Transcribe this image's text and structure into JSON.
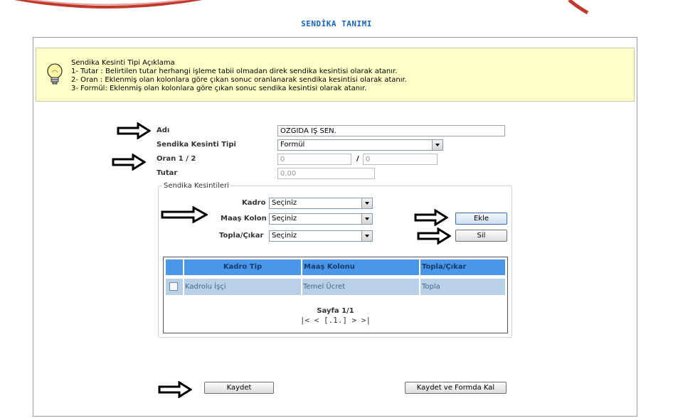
{
  "page": {
    "title": "SENDİKA TANIMI"
  },
  "info": {
    "lines": [
      "Sendika Kesinti Tipi Açıklama",
      "1- Tutar : Belirtilen tutar herhangi işleme tabii olmadan direk sendika kesintisi olarak atanır.",
      "2- Oran : Eklenmiş olan kolonlara göre çıkan sonuc oranlanarak sendika kesintisi olarak atanır.",
      "3- Formül: Eklenmiş olan kolonlara göre çıkan sonuc sendika kesintisi olarak atanır."
    ]
  },
  "form": {
    "adi_label": "Adı",
    "adi_value": "ÖZGIDA İŞ SEN.",
    "tip_label": "Sendika Kesinti Tipi",
    "tip_value": "Formül",
    "oran_label": "Oran 1 / 2",
    "oran1_value": "0",
    "oran_sep": "/",
    "oran2_value": "0",
    "tutar_label": "Tutar",
    "tutar_value": "0,00"
  },
  "kesintiler": {
    "legend": "Sendika Kesintileri",
    "kadro_label": "Kadro",
    "kadro_value": "Seçiniz",
    "maas_label": "Maaş Kolon",
    "maas_value": "Seçiniz",
    "topla_label": "Topla/Çıkar",
    "topla_value": "Seçiniz",
    "ekle_label": "Ekle",
    "sil_label": "Sil",
    "table": {
      "headers": [
        "Kadro Tip",
        "Maaş Kolonu",
        "Topla/Çıkar"
      ],
      "rows": [
        {
          "checked": false,
          "cells": [
            "Kadrolu İşçi",
            "Temel Ücret",
            "Topla"
          ]
        }
      ]
    },
    "pager": {
      "page_text": "Sayfa 1/1",
      "nav": "|<  <  [.1.]  >  >|"
    }
  },
  "footer": {
    "kaydet_label": "Kaydet",
    "kaydet_kal_label": "Kaydet ve Formda Kal"
  },
  "colors": {
    "title": "#1565c0",
    "info_bg": "#ffffc8",
    "grid_header": "#4a96e8",
    "grid_row": "#b9d1e6"
  }
}
